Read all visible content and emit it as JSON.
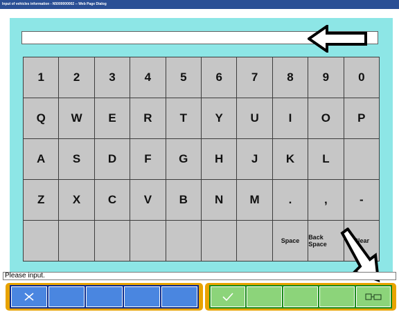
{
  "window": {
    "title": "Input of vehicles information - N5000000002 -- Web Page Dialog"
  },
  "input": {
    "value": ""
  },
  "keyboard": {
    "keys": [
      "1",
      "2",
      "3",
      "4",
      "5",
      "6",
      "7",
      "8",
      "9",
      "0",
      "",
      "Q",
      "W",
      "E",
      "R",
      "T",
      "Y",
      "U",
      "I",
      "O",
      "P",
      "",
      "A",
      "S",
      "D",
      "F",
      "G",
      "H",
      "J",
      "K",
      "L",
      "",
      "",
      "Z",
      "X",
      "C",
      "V",
      "B",
      "N",
      "M",
      ".",
      ",",
      "-",
      "\\",
      "",
      "",
      "",
      "",
      "",
      "",
      "",
      "Space",
      "Back Space",
      "Clear"
    ],
    "space_label": "Space",
    "backspace_label": "Back Space",
    "clear_label": "Clear"
  },
  "status": {
    "text": "Please input."
  },
  "toolbar": {
    "left_icons": [
      "cancel-icon"
    ],
    "right_icons": [
      "checkmark-icon",
      "print-icon"
    ]
  },
  "colors": {
    "panel": "#8de6e6",
    "key": "#c6c6c6",
    "titlebar": "#2a4f95",
    "toolbar_frame": "#e8a300",
    "blue_button": "#4a86e0",
    "green_button": "#8cd47a"
  }
}
